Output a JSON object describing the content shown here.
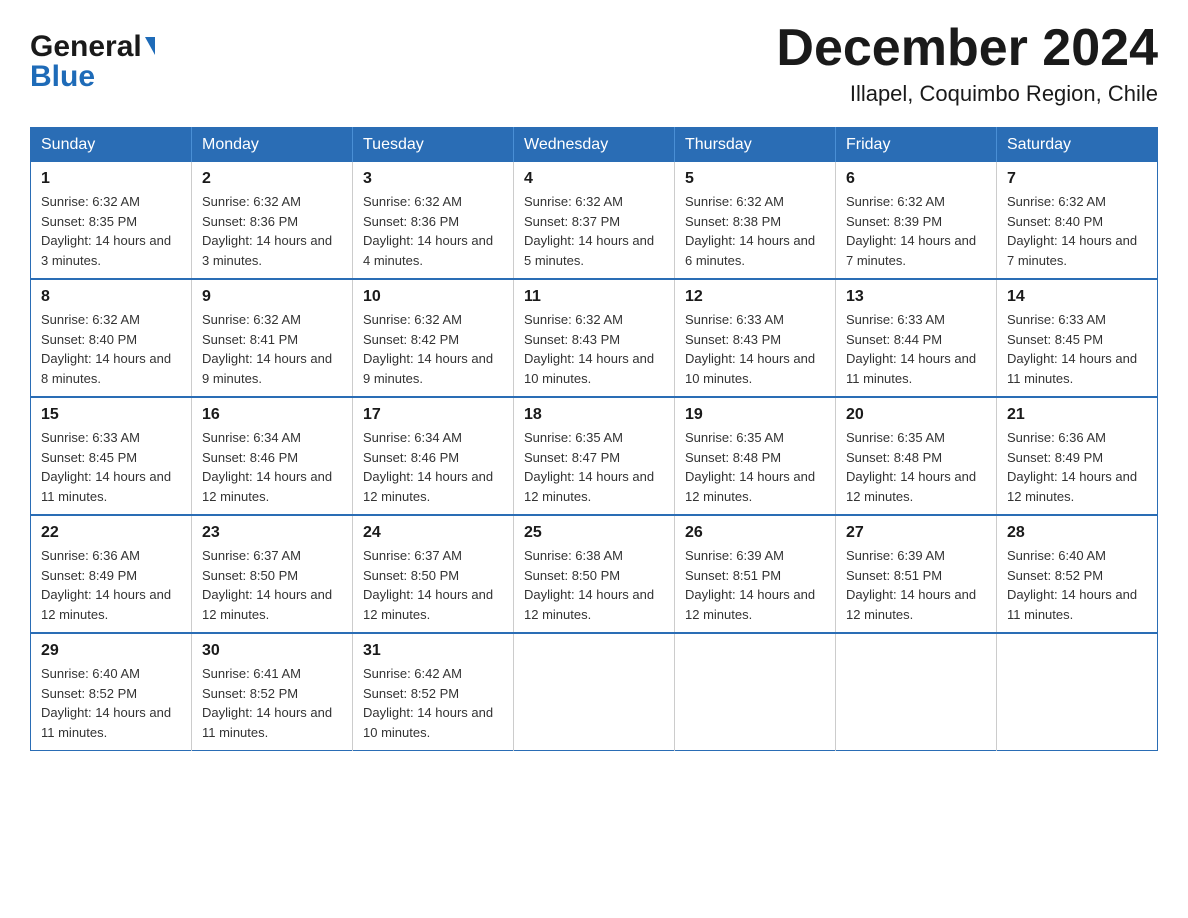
{
  "header": {
    "logo_general": "General",
    "logo_blue": "Blue",
    "month_title": "December 2024",
    "location": "Illapel, Coquimbo Region, Chile"
  },
  "weekdays": [
    "Sunday",
    "Monday",
    "Tuesday",
    "Wednesday",
    "Thursday",
    "Friday",
    "Saturday"
  ],
  "weeks": [
    [
      {
        "day": "1",
        "sunrise": "6:32 AM",
        "sunset": "8:35 PM",
        "daylight": "14 hours and 3 minutes."
      },
      {
        "day": "2",
        "sunrise": "6:32 AM",
        "sunset": "8:36 PM",
        "daylight": "14 hours and 3 minutes."
      },
      {
        "day": "3",
        "sunrise": "6:32 AM",
        "sunset": "8:36 PM",
        "daylight": "14 hours and 4 minutes."
      },
      {
        "day": "4",
        "sunrise": "6:32 AM",
        "sunset": "8:37 PM",
        "daylight": "14 hours and 5 minutes."
      },
      {
        "day": "5",
        "sunrise": "6:32 AM",
        "sunset": "8:38 PM",
        "daylight": "14 hours and 6 minutes."
      },
      {
        "day": "6",
        "sunrise": "6:32 AM",
        "sunset": "8:39 PM",
        "daylight": "14 hours and 7 minutes."
      },
      {
        "day": "7",
        "sunrise": "6:32 AM",
        "sunset": "8:40 PM",
        "daylight": "14 hours and 7 minutes."
      }
    ],
    [
      {
        "day": "8",
        "sunrise": "6:32 AM",
        "sunset": "8:40 PM",
        "daylight": "14 hours and 8 minutes."
      },
      {
        "day": "9",
        "sunrise": "6:32 AM",
        "sunset": "8:41 PM",
        "daylight": "14 hours and 9 minutes."
      },
      {
        "day": "10",
        "sunrise": "6:32 AM",
        "sunset": "8:42 PM",
        "daylight": "14 hours and 9 minutes."
      },
      {
        "day": "11",
        "sunrise": "6:32 AM",
        "sunset": "8:43 PM",
        "daylight": "14 hours and 10 minutes."
      },
      {
        "day": "12",
        "sunrise": "6:33 AM",
        "sunset": "8:43 PM",
        "daylight": "14 hours and 10 minutes."
      },
      {
        "day": "13",
        "sunrise": "6:33 AM",
        "sunset": "8:44 PM",
        "daylight": "14 hours and 11 minutes."
      },
      {
        "day": "14",
        "sunrise": "6:33 AM",
        "sunset": "8:45 PM",
        "daylight": "14 hours and 11 minutes."
      }
    ],
    [
      {
        "day": "15",
        "sunrise": "6:33 AM",
        "sunset": "8:45 PM",
        "daylight": "14 hours and 11 minutes."
      },
      {
        "day": "16",
        "sunrise": "6:34 AM",
        "sunset": "8:46 PM",
        "daylight": "14 hours and 12 minutes."
      },
      {
        "day": "17",
        "sunrise": "6:34 AM",
        "sunset": "8:46 PM",
        "daylight": "14 hours and 12 minutes."
      },
      {
        "day": "18",
        "sunrise": "6:35 AM",
        "sunset": "8:47 PM",
        "daylight": "14 hours and 12 minutes."
      },
      {
        "day": "19",
        "sunrise": "6:35 AM",
        "sunset": "8:48 PM",
        "daylight": "14 hours and 12 minutes."
      },
      {
        "day": "20",
        "sunrise": "6:35 AM",
        "sunset": "8:48 PM",
        "daylight": "14 hours and 12 minutes."
      },
      {
        "day": "21",
        "sunrise": "6:36 AM",
        "sunset": "8:49 PM",
        "daylight": "14 hours and 12 minutes."
      }
    ],
    [
      {
        "day": "22",
        "sunrise": "6:36 AM",
        "sunset": "8:49 PM",
        "daylight": "14 hours and 12 minutes."
      },
      {
        "day": "23",
        "sunrise": "6:37 AM",
        "sunset": "8:50 PM",
        "daylight": "14 hours and 12 minutes."
      },
      {
        "day": "24",
        "sunrise": "6:37 AM",
        "sunset": "8:50 PM",
        "daylight": "14 hours and 12 minutes."
      },
      {
        "day": "25",
        "sunrise": "6:38 AM",
        "sunset": "8:50 PM",
        "daylight": "14 hours and 12 minutes."
      },
      {
        "day": "26",
        "sunrise": "6:39 AM",
        "sunset": "8:51 PM",
        "daylight": "14 hours and 12 minutes."
      },
      {
        "day": "27",
        "sunrise": "6:39 AM",
        "sunset": "8:51 PM",
        "daylight": "14 hours and 12 minutes."
      },
      {
        "day": "28",
        "sunrise": "6:40 AM",
        "sunset": "8:52 PM",
        "daylight": "14 hours and 11 minutes."
      }
    ],
    [
      {
        "day": "29",
        "sunrise": "6:40 AM",
        "sunset": "8:52 PM",
        "daylight": "14 hours and 11 minutes."
      },
      {
        "day": "30",
        "sunrise": "6:41 AM",
        "sunset": "8:52 PM",
        "daylight": "14 hours and 11 minutes."
      },
      {
        "day": "31",
        "sunrise": "6:42 AM",
        "sunset": "8:52 PM",
        "daylight": "14 hours and 10 minutes."
      },
      null,
      null,
      null,
      null
    ]
  ]
}
